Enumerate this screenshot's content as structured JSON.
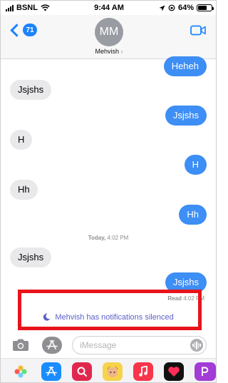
{
  "status_bar": {
    "carrier": "BSNL",
    "time": "9:44 AM",
    "battery": "64%",
    "battery_level": 0.64
  },
  "header": {
    "back_count": "71",
    "avatar_initials": "MM",
    "contact_name": "Mehvish",
    "icons": {
      "back": "chevron-left-icon",
      "video": "video-camera-icon",
      "contact_chevron": "chevron-right-icon"
    }
  },
  "messages": [
    {
      "direction": "outgoing",
      "text": "Heheh"
    },
    {
      "direction": "incoming",
      "text": "Jsjshs"
    },
    {
      "direction": "outgoing",
      "text": "Jsjshs"
    },
    {
      "direction": "incoming",
      "text": "H"
    },
    {
      "direction": "outgoing",
      "text": "H"
    },
    {
      "direction": "incoming",
      "text": "Hh"
    },
    {
      "direction": "outgoing",
      "text": "Hh"
    },
    {
      "direction": "incoming",
      "text": "Jsjshs"
    },
    {
      "direction": "outgoing",
      "text": "Jsjshs"
    }
  ],
  "timestamp": {
    "day": "Today,",
    "time": "4:02 PM"
  },
  "read_receipt": {
    "label": "Read",
    "time": "4:02 PM"
  },
  "notice": {
    "text": "Mehvish has notifications silenced",
    "icon": "moon-icon"
  },
  "highlight_color": "#e8141c",
  "input_bar": {
    "placeholder": "iMessage",
    "icons": [
      "camera-icon",
      "app-store-icon",
      "audio-waveform-icon"
    ]
  },
  "app_drawer": {
    "apps": [
      {
        "name": "photos-app-icon",
        "color": "#f3f3f3"
      },
      {
        "name": "app-store-app-icon",
        "color": "#1a8cff"
      },
      {
        "name": "search-images-app-icon",
        "color": "#e0284f"
      },
      {
        "name": "memoji-app-icon",
        "color": "#f7d34b"
      },
      {
        "name": "music-app-icon",
        "color": "#f8354b"
      },
      {
        "name": "digital-touch-app-icon",
        "color": "#111111"
      },
      {
        "name": "more-apps-icon",
        "color": "#a33bd6"
      }
    ]
  },
  "colors": {
    "accent": "#1a84ff",
    "outgoing_bubble": "#3d8ef5",
    "incoming_bubble": "#e9e9eb",
    "notice": "#5b5fc7"
  }
}
